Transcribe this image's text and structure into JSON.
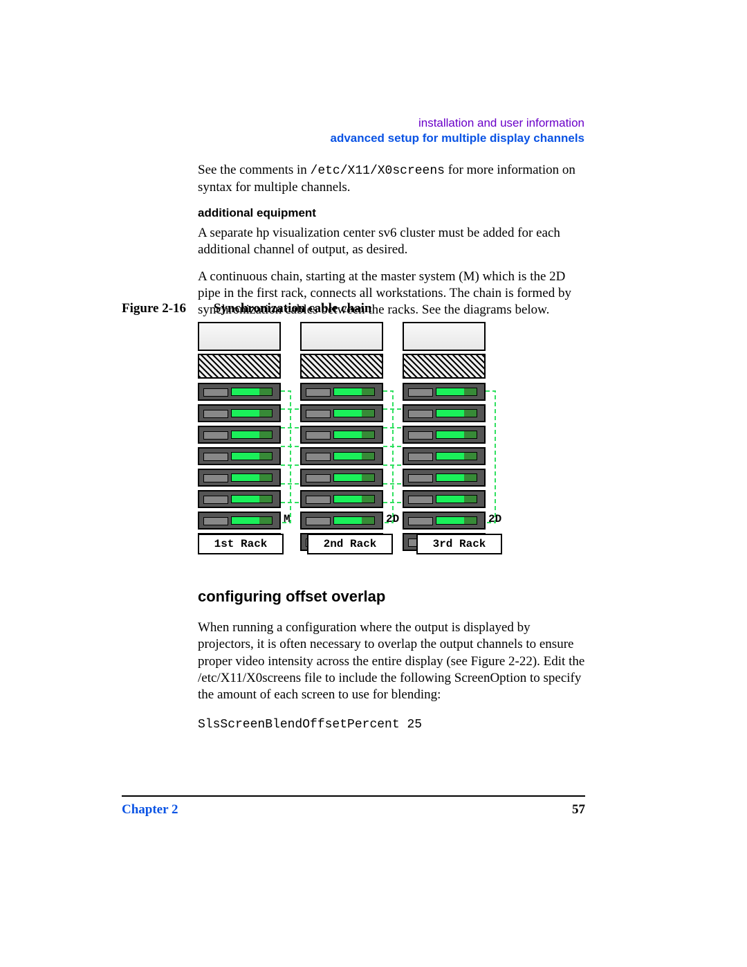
{
  "header": {
    "line1": "installation and user information",
    "line2": "advanced setup for multiple display channels"
  },
  "intro": {
    "p1_pre": "See the comments in ",
    "p1_code": "/etc/X11/X0screens",
    "p1_post": " for more information on syntax for multiple channels.",
    "subhead": "additional equipment",
    "p2": "A separate hp visualization center sv6 cluster must be added for each additional channel of output, as desired.",
    "p3": "A continuous chain, starting at the master system (M) which is the 2D pipe in the first rack, connects all workstations. The chain is formed by synchronization cables between the racks.  See the diagrams below."
  },
  "figure": {
    "number": "Figure 2-16",
    "caption": "Synchronization cable chain",
    "tag_m": "M",
    "tag_2d_a": "2D",
    "tag_2d_b": "2D",
    "rack_labels": [
      "1st Rack",
      "2nd Rack",
      "3rd Rack"
    ]
  },
  "section2": {
    "heading": "configuring offset overlap",
    "p1": "When running a configuration where the output is displayed by projectors, it is often necessary to overlap the output channels to ensure proper video intensity across the entire display (see Figure 2-22). Edit the /etc/X11/X0screens file to include the following ScreenOption to specify the amount of each screen to use for blending:",
    "code": "SlsScreenBlendOffsetPercent 25"
  },
  "footer": {
    "chapter": "Chapter 2",
    "page": "57"
  }
}
